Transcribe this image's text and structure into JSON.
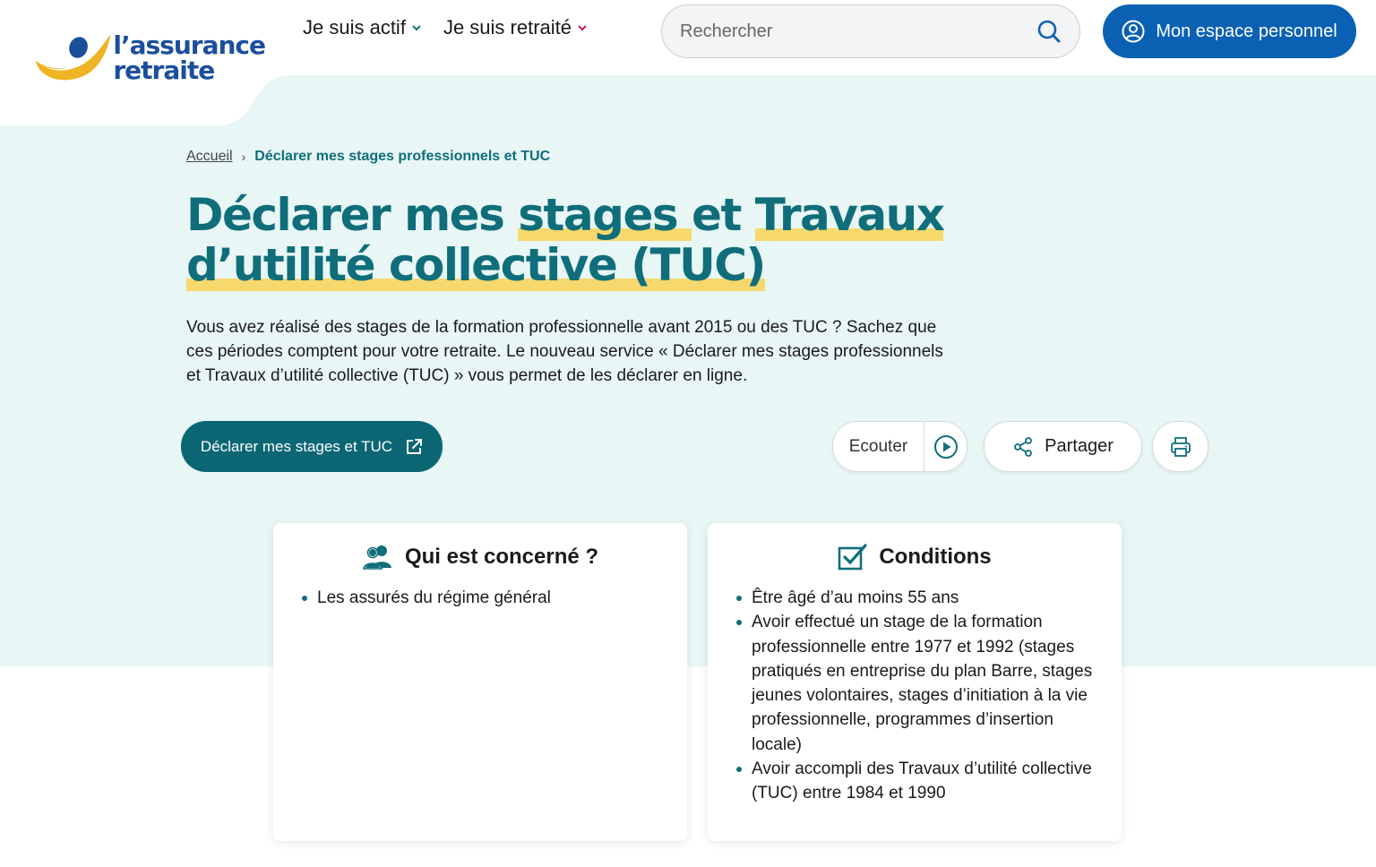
{
  "header": {
    "logo_line1": "l’assurance",
    "logo_line2": "retraite",
    "nav": [
      {
        "label": "Je suis actif",
        "accent": "#0f6e7a"
      },
      {
        "label": "Je suis retraité",
        "accent": "#c0185a"
      }
    ],
    "search_placeholder": "Rechercher",
    "account_label": "Mon espace personnel"
  },
  "breadcrumb": {
    "home": "Accueil",
    "current": "Déclarer mes stages professionnels et TUC"
  },
  "page": {
    "title_1": "Déclarer mes ",
    "title_hl1": "stages ",
    "title_2": "et ",
    "title_hl2": "Travaux",
    "title_hl3": "d’utilité collective (TUC)",
    "intro": "Vous avez réalisé des stages de la formation professionnelle avant 2015 ou des TUC ? Sachez que ces périodes comptent pour votre retraite. Le nouveau service « Déclarer mes stages professionnels et Travaux d’utilité collective (TUC) » vous permet de les déclarer en ligne."
  },
  "actions": {
    "cta": "Déclarer mes stages et TUC",
    "listen": "Ecouter",
    "share": "Partager"
  },
  "cards": {
    "who": {
      "title": "Qui est concerné ?",
      "items": [
        "Les assurés du régime général"
      ]
    },
    "conditions": {
      "title": "Conditions",
      "items": [
        "Être âgé d’au moins 55 ans",
        "Avoir effectué un stage de la formation professionnelle entre 1977 et 1992 (stages pratiqués en entreprise du plan Barre, stages jeunes volontaires, stages d’initiation à la vie professionnelle, programmes d’insertion locale)",
        "Avoir accompli des Travaux d’utilité collective (TUC) entre 1984 et 1990"
      ]
    }
  },
  "colors": {
    "teal": "#0f6e7a",
    "blue": "#0a61b4",
    "hero_bg": "#e8f6f5",
    "highlight": "#f6d86d",
    "logo_yellow": "#f0b323"
  }
}
